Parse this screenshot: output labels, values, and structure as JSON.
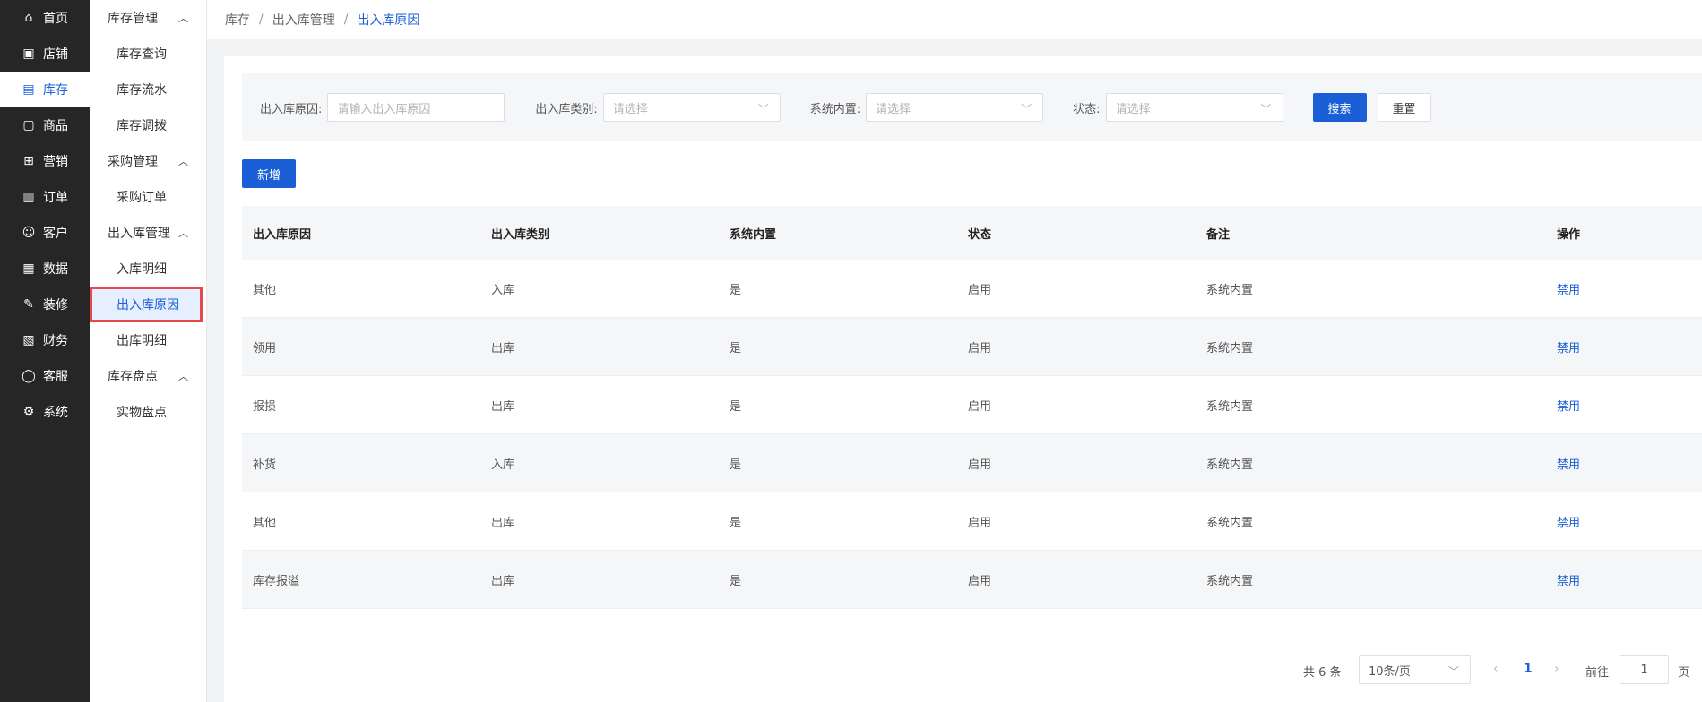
{
  "nav": {
    "items": [
      {
        "label": "首页",
        "icon": "home-icon",
        "glyph": "⌂"
      },
      {
        "label": "店铺",
        "icon": "store-icon",
        "glyph": "▣"
      },
      {
        "label": "库存",
        "icon": "inventory-icon",
        "glyph": "▤"
      },
      {
        "label": "商品",
        "icon": "goods-icon",
        "glyph": "▢"
      },
      {
        "label": "营销",
        "icon": "gift-icon",
        "glyph": "⊞"
      },
      {
        "label": "订单",
        "icon": "order-icon",
        "glyph": "▥"
      },
      {
        "label": "客户",
        "icon": "customer-icon",
        "glyph": "☺"
      },
      {
        "label": "数据",
        "icon": "data-icon",
        "glyph": "▦"
      },
      {
        "label": "装修",
        "icon": "decorate-icon",
        "glyph": "✎"
      },
      {
        "label": "财务",
        "icon": "finance-icon",
        "glyph": "▧"
      },
      {
        "label": "客服",
        "icon": "chat-icon",
        "glyph": "◯"
      },
      {
        "label": "系统",
        "icon": "settings-icon",
        "glyph": "⚙"
      }
    ],
    "active_index": 2
  },
  "subnav": {
    "groups": [
      {
        "label": "库存管理",
        "items": [
          "库存查询",
          "库存流水",
          "库存调拨"
        ]
      },
      {
        "label": "采购管理",
        "items": [
          "采购订单"
        ]
      },
      {
        "label": "出入库管理",
        "items": [
          "入库明细",
          "出入库原因",
          "出库明细"
        ]
      },
      {
        "label": "库存盘点",
        "items": [
          "实物盘点"
        ]
      }
    ],
    "collapse_glyph": "︿"
  },
  "breadcrumb": {
    "items": [
      "库存",
      "出入库管理",
      "出入库原因"
    ],
    "separator": "/"
  },
  "filter": {
    "reason_label": "出入库原因:",
    "reason_placeholder": "请输入出入库原因",
    "category_label": "出入库类别:",
    "category_placeholder": "请选择",
    "builtin_label": "系统内置:",
    "builtin_placeholder": "请选择",
    "status_label": "状态:",
    "status_placeholder": "请选择",
    "search_label": "搜索",
    "reset_label": "重置"
  },
  "add_label": "新增",
  "table": {
    "columns": [
      "出入库原因",
      "出入库类别",
      "系统内置",
      "状态",
      "备注",
      "操作"
    ],
    "rows": [
      {
        "reason": "其他",
        "category": "入库",
        "builtin": "是",
        "status": "启用",
        "remark": "系统内置",
        "action": "禁用"
      },
      {
        "reason": "领用",
        "category": "出库",
        "builtin": "是",
        "status": "启用",
        "remark": "系统内置",
        "action": "禁用"
      },
      {
        "reason": "报损",
        "category": "出库",
        "builtin": "是",
        "status": "启用",
        "remark": "系统内置",
        "action": "禁用"
      },
      {
        "reason": "补货",
        "category": "入库",
        "builtin": "是",
        "status": "启用",
        "remark": "系统内置",
        "action": "禁用"
      },
      {
        "reason": "其他",
        "category": "出库",
        "builtin": "是",
        "status": "启用",
        "remark": "系统内置",
        "action": "禁用"
      },
      {
        "reason": "库存报溢",
        "category": "出库",
        "builtin": "是",
        "status": "启用",
        "remark": "系统内置",
        "action": "禁用"
      }
    ]
  },
  "pagination": {
    "total": "共 6 条",
    "page_size": "10条/页",
    "current_page": "1",
    "goto_label": "前往",
    "goto_value": "1",
    "page_suffix": "页"
  },
  "colors": {
    "primary": "#1a5fd6",
    "nav_bg": "#262626",
    "highlight_border": "#e8474c"
  }
}
